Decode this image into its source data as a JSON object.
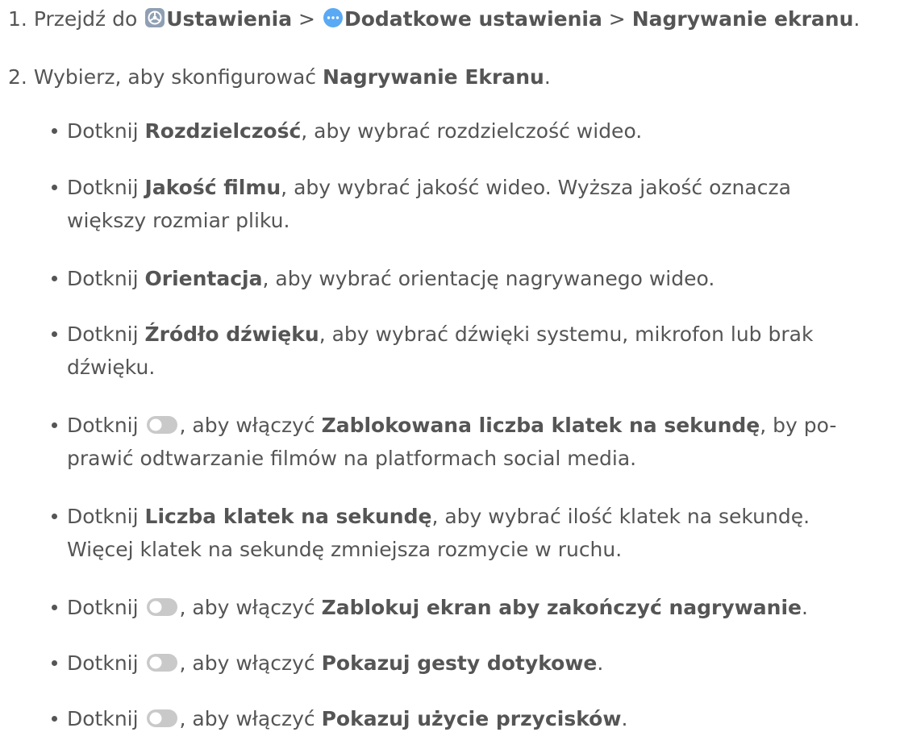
{
  "steps": [
    {
      "number": "1.",
      "prefix": "Przejdź do",
      "settings": "Ustawienia",
      "sep1": ">",
      "additional": "Dodatkowe ustawienia",
      "sep2": ">",
      "recording": "Nagrywanie ekranu",
      "end": "."
    },
    {
      "number": "2.",
      "prefix": "Wybierz, aby skonfigurować",
      "strong": "Nagrywanie Ekranu",
      "end": "."
    }
  ],
  "bullets": [
    {
      "pre": "Dotknij",
      "strong": "Rozdzielczość",
      "post": ", aby wybrać rozdzielczość wideo."
    },
    {
      "pre": "Dotknij",
      "strong": "Jakość filmu",
      "post": ", aby wybrać jakość wideo. Wyższa jakość oznacza",
      "post2": "większy rozmiar pliku."
    },
    {
      "pre": "Dotknij",
      "strong": "Orientacja",
      "post": ", aby wybrać orientację nagrywanego wideo."
    },
    {
      "pre": "Dotknij",
      "strong": "Źródło dźwięku",
      "post": ", aby wybrać dźwięki systemu, mikrofon lub brak",
      "post2": "dźwięku."
    },
    {
      "pre": "Dotknij",
      "mid": ", aby włączyć",
      "strong": "Zablokowana liczba klatek na sekundę",
      "post": ", by po-",
      "post2": "prawić odtwarzanie filmów na platformach social media."
    },
    {
      "pre": "Dotknij",
      "strong": "Liczba klatek na sekundę",
      "post": ", aby wybrać ilość klatek na sekundę.",
      "post2": "Więcej klatek na sekundę zmniejsza rozmycie w ruchu."
    },
    {
      "pre": "Dotknij",
      "mid": ", aby włączyć",
      "strong": "Zablokuj ekran aby zakończyć nagrywanie",
      "post": "."
    },
    {
      "pre": "Dotknij",
      "mid": ", aby włączyć",
      "strong": "Pokazuj gesty dotykowe",
      "post": "."
    },
    {
      "pre": "Dotknij",
      "mid": ", aby włączyć",
      "strong": "Pokazuj użycie przycisków",
      "post": "."
    }
  ],
  "icons": {
    "settings": "settings-gear-icon",
    "additional": "more-dots-icon",
    "toggle": "toggle-switch-icon"
  },
  "colors": {
    "text": "#555555",
    "toggle_track": "#c9c9c9",
    "settings_icon": "#8f9fb4",
    "additional_icon": "#5aa9f4"
  }
}
